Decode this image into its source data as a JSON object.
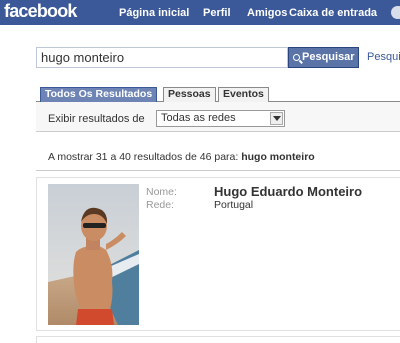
{
  "header": {
    "logo": "facebook",
    "nav": [
      "Página inicial",
      "Perfil",
      "Amigos",
      "Caixa de entrada"
    ]
  },
  "search": {
    "value": "hugo monteiro",
    "button_label": "Pesquisar",
    "advanced_link": "Pesquis"
  },
  "tabs": [
    "Todos Os Resultados",
    "Pessoas",
    "Eventos"
  ],
  "filter": {
    "label": "Exibir resultados de",
    "selected": "Todas as redes"
  },
  "results": {
    "prefix": "A mostrar 31 a 40 resultados de 46 para: ",
    "query": "hugo monteiro"
  },
  "result": {
    "name_label": "Nome:",
    "network_label": "Rede:",
    "name": "Hugo Eduardo Monteiro",
    "network": "Portugal"
  },
  "colors": {
    "brand": "#3b5998",
    "tab_active": "#6d84b4",
    "button": "#5b74a8"
  }
}
